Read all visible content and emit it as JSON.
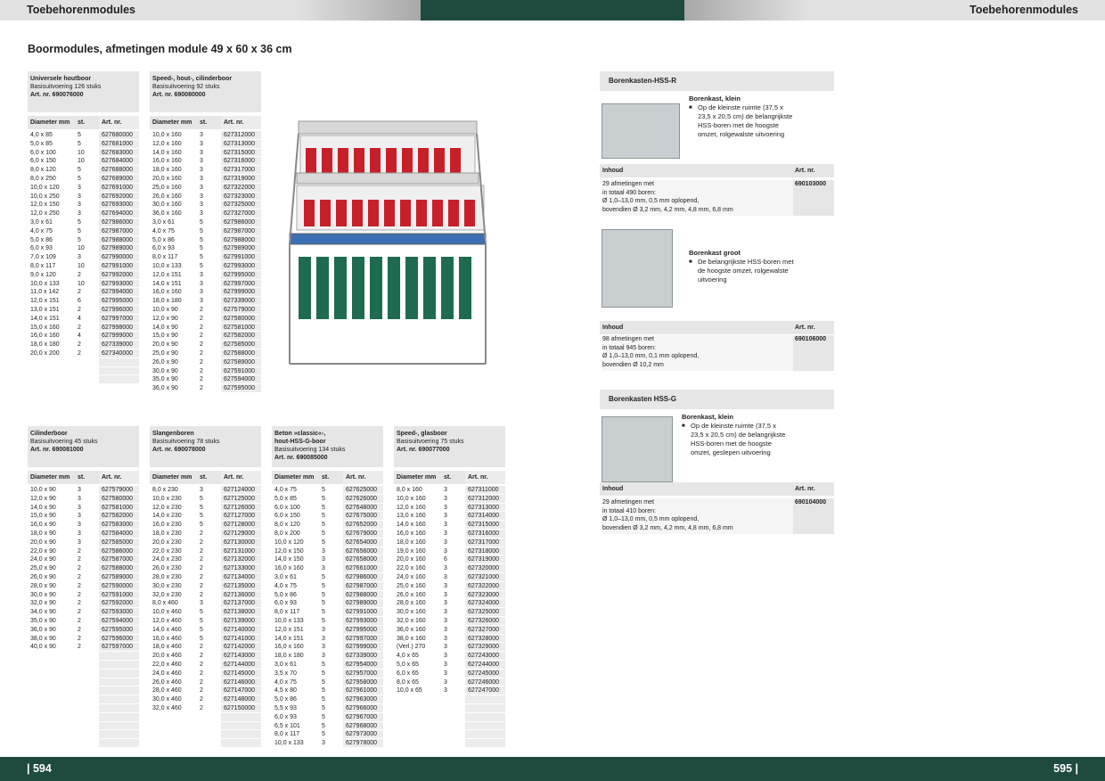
{
  "header": {
    "left": "Toebehorenmodules",
    "right": "Toebehorenmodules"
  },
  "title": "Boormodules, afmetingen module 49 x 60 x 36 cm",
  "footer": {
    "left": "| 594",
    "right": "595 |"
  },
  "col_headers": {
    "dia": "Diameter mm",
    "st": "st.",
    "art": "Art. nr."
  },
  "modules": [
    {
      "name": "Universele houtboor",
      "sub": "Basisuitvoering 126 stuks",
      "art": "Art. nr. 690076000",
      "rows": [
        [
          "4,0 x 85",
          "5",
          "627680000"
        ],
        [
          "5,0 x 85",
          "5",
          "627681000"
        ],
        [
          "6,0 x 100",
          "10",
          "627683000"
        ],
        [
          "6,0 x 150",
          "10",
          "627684000"
        ],
        [
          "8,0 x 120",
          "5",
          "627688000"
        ],
        [
          "8,0 x 250",
          "5",
          "627689000"
        ],
        [
          "10,0 x 120",
          "3",
          "627691000"
        ],
        [
          "10,0 x 250",
          "3",
          "627692000"
        ],
        [
          "12,0 x 150",
          "3",
          "627693000"
        ],
        [
          "12,0 x 250",
          "3",
          "627694000"
        ],
        [
          "3,0 x 61",
          "5",
          "627986000"
        ],
        [
          "4,0 x 75",
          "5",
          "627987000"
        ],
        [
          "5,0 x 86",
          "5",
          "627988000"
        ],
        [
          "6,0 x 93",
          "10",
          "627989000"
        ],
        [
          "7,0 x 109",
          "3",
          "627990000"
        ],
        [
          "8,0 x 117",
          "10",
          "627991000"
        ],
        [
          "9,0 x 120",
          "2",
          "627992000"
        ],
        [
          "10,0 x 133",
          "10",
          "627993000"
        ],
        [
          "11,0 x 142",
          "2",
          "627994000"
        ],
        [
          "12,0 x 151",
          "6",
          "627995000"
        ],
        [
          "13,0 x 151",
          "2",
          "627996000"
        ],
        [
          "14,0 x 151",
          "4",
          "627997000"
        ],
        [
          "15,0 x 160",
          "2",
          "627998000"
        ],
        [
          "16,0 x 160",
          "4",
          "627999000"
        ],
        [
          "18,0 x 180",
          "2",
          "627339000"
        ],
        [
          "20,0 x 200",
          "2",
          "627340000"
        ],
        [
          "",
          "",
          ""
        ],
        [
          "",
          "",
          ""
        ],
        [
          "",
          "",
          ""
        ]
      ]
    },
    {
      "name": "Speed-, hout-, cilinderboor",
      "sub": "Basisuitvoering 92 stuks",
      "art": "Art. nr. 690080000",
      "rows": [
        [
          "10,0 x 160",
          "3",
          "627312000"
        ],
        [
          "12,0 x 160",
          "3",
          "627313000"
        ],
        [
          "14,0 x 160",
          "3",
          "627315000"
        ],
        [
          "16,0 x 160",
          "3",
          "627316000"
        ],
        [
          "18,0 x 160",
          "3",
          "627317000"
        ],
        [
          "20,0 x 160",
          "3",
          "627319000"
        ],
        [
          "25,0 x 160",
          "3",
          "627322000"
        ],
        [
          "26,0 x 160",
          "3",
          "627323000"
        ],
        [
          "30,0 x 160",
          "3",
          "627325000"
        ],
        [
          "36,0 x 160",
          "3",
          "627327000"
        ],
        [
          "3,0 x 61",
          "5",
          "627986000"
        ],
        [
          "4,0 x 75",
          "5",
          "627987000"
        ],
        [
          "5,0 x 86",
          "5",
          "627988000"
        ],
        [
          "6,0 x 93",
          "5",
          "627989000"
        ],
        [
          "8,0 x 117",
          "5",
          "627991000"
        ],
        [
          "10,0 x 133",
          "5",
          "627993000"
        ],
        [
          "12,0 x 151",
          "3",
          "627995000"
        ],
        [
          "14,0 x 151",
          "3",
          "627997000"
        ],
        [
          "16,0 x 160",
          "3",
          "627999000"
        ],
        [
          "18,0 x 180",
          "3",
          "627339000"
        ],
        [
          "10,0 x 90",
          "2",
          "627579000"
        ],
        [
          "12,0 x 90",
          "2",
          "627580000"
        ],
        [
          "14,0 x 90",
          "2",
          "627581000"
        ],
        [
          "15,0 x 90",
          "2",
          "627582000"
        ],
        [
          "20,0 x 90",
          "2",
          "627585000"
        ],
        [
          "25,0 x 90",
          "2",
          "627588000"
        ],
        [
          "26,0 x 90",
          "2",
          "627589000"
        ],
        [
          "30,0 x 90",
          "2",
          "627591000"
        ],
        [
          "35,0 x 90",
          "2",
          "627594000"
        ],
        [
          "36,0 x 90",
          "2",
          "627595000"
        ]
      ]
    },
    {
      "name": "Cilinderboor",
      "sub": "Basisuitvoering 45 stuks",
      "art": "Art. nr. 690081000",
      "rows": [
        [
          "10,0 x 90",
          "3",
          "627579000"
        ],
        [
          "12,0 x 90",
          "3",
          "627580000"
        ],
        [
          "14,0 x 90",
          "3",
          "627581000"
        ],
        [
          "15,0 x 90",
          "3",
          "627582000"
        ],
        [
          "16,0 x 90",
          "3",
          "627583000"
        ],
        [
          "18,0 x 90",
          "3",
          "627584000"
        ],
        [
          "20,0 x 90",
          "3",
          "627585000"
        ],
        [
          "22,0 x 90",
          "2",
          "627586000"
        ],
        [
          "24,0 x 90",
          "2",
          "627587000"
        ],
        [
          "25,0 x 90",
          "2",
          "627588000"
        ],
        [
          "26,0 x 90",
          "2",
          "627589000"
        ],
        [
          "28,0 x 90",
          "2",
          "627590000"
        ],
        [
          "30,0 x 90",
          "2",
          "627591000"
        ],
        [
          "32,0 x 90",
          "2",
          "627592000"
        ],
        [
          "34,0 x 90",
          "2",
          "627593000"
        ],
        [
          "35,0 x 90",
          "2",
          "627594000"
        ],
        [
          "36,0 x 90",
          "2",
          "627595000"
        ],
        [
          "38,0 x 90",
          "2",
          "627596000"
        ],
        [
          "40,0 x 90",
          "2",
          "627597000"
        ],
        [
          "",
          "",
          ""
        ],
        [
          "",
          "",
          ""
        ],
        [
          "",
          "",
          ""
        ],
        [
          "",
          "",
          ""
        ],
        [
          "",
          "",
          ""
        ],
        [
          "",
          "",
          ""
        ],
        [
          "",
          "",
          ""
        ],
        [
          "",
          "",
          ""
        ],
        [
          "",
          "",
          ""
        ],
        [
          "",
          "",
          ""
        ],
        [
          "",
          "",
          ""
        ]
      ]
    },
    {
      "name": "Slangenboren",
      "sub": "Basisuitvoering 78 stuks",
      "art": "Art. nr. 690078000",
      "rows": [
        [
          "8,0 x 230",
          "3",
          "627124000"
        ],
        [
          "10,0 x 230",
          "5",
          "627125000"
        ],
        [
          "12,0 x 230",
          "5",
          "627126000"
        ],
        [
          "14,0 x 230",
          "5",
          "627127000"
        ],
        [
          "16,0 x 230",
          "5",
          "627128000"
        ],
        [
          "18,0 x 230",
          "2",
          "627129000"
        ],
        [
          "20,0 x 230",
          "2",
          "627130000"
        ],
        [
          "22,0 x 230",
          "2",
          "627131000"
        ],
        [
          "24,0 x 230",
          "2",
          "627132000"
        ],
        [
          "26,0 x 230",
          "2",
          "627133000"
        ],
        [
          "28,0 x 230",
          "2",
          "627134000"
        ],
        [
          "30,0 x 230",
          "2",
          "627135000"
        ],
        [
          "32,0 x 230",
          "2",
          "627136000"
        ],
        [
          "8,0 x 460",
          "3",
          "627137000"
        ],
        [
          "10,0 x 460",
          "5",
          "627138000"
        ],
        [
          "12,0 x 460",
          "5",
          "627139000"
        ],
        [
          "14,0 x 460",
          "5",
          "627140000"
        ],
        [
          "16,0 x 460",
          "5",
          "627141000"
        ],
        [
          "18,0 x 460",
          "2",
          "627142000"
        ],
        [
          "20,0 x 460",
          "2",
          "627143000"
        ],
        [
          "22,0 x 460",
          "2",
          "627144000"
        ],
        [
          "24,0 x 460",
          "2",
          "627145000"
        ],
        [
          "26,0 x 460",
          "2",
          "627146000"
        ],
        [
          "28,0 x 460",
          "2",
          "627147000"
        ],
        [
          "30,0 x 460",
          "2",
          "627148000"
        ],
        [
          "32,0 x 460",
          "2",
          "627150000"
        ],
        [
          "",
          "",
          ""
        ],
        [
          "",
          "",
          ""
        ],
        [
          "",
          "",
          ""
        ],
        [
          "",
          "",
          ""
        ]
      ]
    },
    {
      "name": "Beton »classic«-,",
      "name2": "hout-HSS-G-boor",
      "sub": "Basisuitvoering 134 stuks",
      "art": "Art. nr. 690085000",
      "rows": [
        [
          "4,0 x 75",
          "5",
          "627625000"
        ],
        [
          "5,0 x 85",
          "5",
          "627626000"
        ],
        [
          "6,0 x 100",
          "5",
          "627648000"
        ],
        [
          "6,0 x 150",
          "5",
          "627675000"
        ],
        [
          "8,0 x 120",
          "5",
          "627652000"
        ],
        [
          "8,0 x 200",
          "5",
          "627679000"
        ],
        [
          "10,0 x 120",
          "5",
          "627654000"
        ],
        [
          "12,0 x 150",
          "3",
          "627656000"
        ],
        [
          "14,0 x 150",
          "3",
          "627658000"
        ],
        [
          "16,0 x 160",
          "3",
          "627661000"
        ],
        [
          "3,0 x 61",
          "5",
          "627986000"
        ],
        [
          "4,0 x 75",
          "5",
          "627987000"
        ],
        [
          "5,0 x 86",
          "5",
          "627988000"
        ],
        [
          "6,0 x 93",
          "5",
          "627989000"
        ],
        [
          "8,0 x 117",
          "5",
          "627991000"
        ],
        [
          "10,0 x 133",
          "5",
          "627993000"
        ],
        [
          "12,0 x 151",
          "3",
          "627995000"
        ],
        [
          "14,0 x 151",
          "3",
          "627997000"
        ],
        [
          "16,0 x 160",
          "3",
          "627999000"
        ],
        [
          "18,0 x 180",
          "3",
          "627339000"
        ],
        [
          "3,0 x 61",
          "5",
          "627954000"
        ],
        [
          "3,5 x 70",
          "5",
          "627957000"
        ],
        [
          "4,0 x 75",
          "5",
          "627958000"
        ],
        [
          "4,5 x 80",
          "5",
          "627961000"
        ],
        [
          "5,0 x 86",
          "5",
          "627963000"
        ],
        [
          "5,5 x 93",
          "5",
          "627966000"
        ],
        [
          "6,0 x 93",
          "5",
          "627967000"
        ],
        [
          "6,5 x 101",
          "5",
          "627968000"
        ],
        [
          "8,0 x 117",
          "5",
          "627973000"
        ],
        [
          "10,0 x 133",
          "3",
          "627978000"
        ]
      ]
    },
    {
      "name": "Speed-, glasboor",
      "sub": "Basisuitvoering 75 stuks",
      "art": "Art. nr. 690077000",
      "rows": [
        [
          "8,0 x 160",
          "3",
          "627311000"
        ],
        [
          "10,0 x 160",
          "3",
          "627312000"
        ],
        [
          "12,0 x 160",
          "3",
          "627313000"
        ],
        [
          "13,0 x 160",
          "3",
          "627314000"
        ],
        [
          "14,0 x 160",
          "3",
          "627315000"
        ],
        [
          "16,0 x 160",
          "3",
          "627316000"
        ],
        [
          "18,0 x 160",
          "3",
          "627317000"
        ],
        [
          "19,0 x 160",
          "3",
          "627318000"
        ],
        [
          "20,0 x 160",
          "6",
          "627319000"
        ],
        [
          "22,0 x 160",
          "3",
          "627320000"
        ],
        [
          "24,0 x 160",
          "3",
          "627321000"
        ],
        [
          "25,0 x 160",
          "3",
          "627322000"
        ],
        [
          "26,0 x 160",
          "3",
          "627323000"
        ],
        [
          "28,0 x 160",
          "3",
          "627324000"
        ],
        [
          "30,0 x 160",
          "3",
          "627325000"
        ],
        [
          "32,0 x 160",
          "3",
          "627326000"
        ],
        [
          "36,0 x 160",
          "3",
          "627327000"
        ],
        [
          "38,0 x 160",
          "3",
          "627328000"
        ],
        [
          "(Verl.) 270",
          "3",
          "627329000"
        ],
        [
          "4,0 x 65",
          "3",
          "627243000"
        ],
        [
          "5,0 x 65",
          "3",
          "627244000"
        ],
        [
          "6,0 x 65",
          "3",
          "627245000"
        ],
        [
          "8,0 x 65",
          "3",
          "627246000"
        ],
        [
          "10,0 x 65",
          "3",
          "627247000"
        ],
        [
          "",
          "",
          ""
        ],
        [
          "",
          "",
          ""
        ],
        [
          "",
          "",
          ""
        ],
        [
          "",
          "",
          ""
        ],
        [
          "",
          "",
          ""
        ],
        [
          "",
          "",
          ""
        ]
      ]
    }
  ],
  "boxes": [
    {
      "head": "Borenkasten-HSS-R",
      "t1": "Borenkast, klein",
      "b1": "Op de kleinste ruimte (37,5 x 23,5 x 20,5 cm) de belangrijkste HSS-boren met de hoogste omzet, rolgewalste uitvoering",
      "ih": "Inhoud",
      "ia": "Art. nr.",
      "c1": "29 afmetingen met",
      "c2": "in totaal 490 boren:",
      "c3": "Ø 1,0–13,0 mm, 0,5 mm oplopend,",
      "c4": "bovendien Ø 3,2 mm, 4,2 mm, 4,8 mm, 6,8 mm",
      "art": "690103000"
    },
    {
      "t1": "Borenkast groot",
      "b1": "De belangrijkste HSS-boren met de hoogste omzet, rolgewalste uitvoering",
      "ih": "Inhoud",
      "ia": "Art. nr.",
      "c1": "98 afmetingen met",
      "c2": "in totaal 945 boren:",
      "c3": "Ø 1,0–13,0 mm, 0,1 mm oplopend,",
      "c4": "bovendien Ø 10,2 mm",
      "art": "690106000"
    },
    {
      "head": "Borenkasten HSS-G",
      "t1": "Borenkast, klein",
      "b1": "Op de kleinste ruimte (37,5 x 23,5 x 20,5 cm) de belangrijkste HSS-boren met de hoogste omzet, geslepen uitvoering",
      "ih": "Inhoud",
      "ia": "Art. nr.",
      "c1": "29 afmetingen met",
      "c2": "in totaal 410 boren:",
      "c3": "Ø 1,0–13,0 mm, 0,5 mm oplopend,",
      "c4": "bovendien Ø 3,2 mm, 4,2 mm, 4,8 mm, 6,8 mm",
      "art": "690104000"
    }
  ],
  "colors": {
    "green": "#1f4a3f",
    "grey": "#e6e6e6"
  }
}
